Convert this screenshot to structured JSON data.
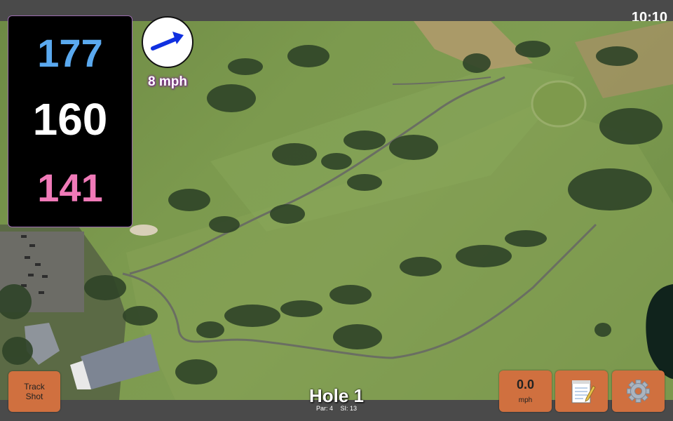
{
  "status": {
    "time": "10:10"
  },
  "distances": {
    "back": "177",
    "center": "160",
    "front": "141"
  },
  "wind": {
    "speed": "8 mph",
    "icon": "wind-arrow-icon"
  },
  "hole": {
    "title": "Hole 1",
    "par": "Par: 4",
    "stroke_index": "SI: 13"
  },
  "buttons": {
    "track_shot": {
      "line1": "Track",
      "line2": "Shot"
    },
    "speed": {
      "value": "0.0",
      "unit": "mph"
    },
    "notes": {
      "icon": "notepad-icon"
    },
    "settings": {
      "icon": "gear-icon"
    }
  },
  "colors": {
    "back_distance": "#5aa9ef",
    "center_distance": "#ffffff",
    "front_distance": "#f07ab8",
    "button": "#d0703f"
  }
}
